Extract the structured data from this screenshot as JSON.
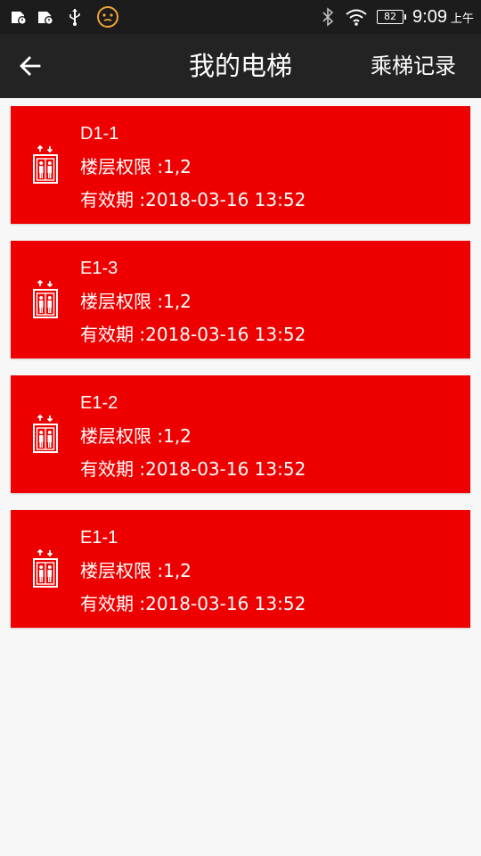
{
  "status_bar": {
    "time": "9:09",
    "ampm": "上午",
    "battery": "82",
    "icons": [
      "storage-card-icon",
      "storage-card-icon",
      "usb-icon",
      "face-icon",
      "bluetooth-icon",
      "wifi-icon",
      "battery-icon"
    ]
  },
  "header": {
    "title": "我的电梯",
    "records_label": "乘梯记录"
  },
  "elevators": [
    {
      "name": "D1-1",
      "floors": "楼层权限 :1,2",
      "validity": "有效期 :2018-03-16 13:52"
    },
    {
      "name": "E1-3",
      "floors": "楼层权限 :1,2",
      "validity": "有效期 :2018-03-16 13:52"
    },
    {
      "name": "E1-2",
      "floors": "楼层权限 :1,2",
      "validity": "有效期 :2018-03-16 13:52"
    },
    {
      "name": "E1-1",
      "floors": "楼层权限 :1,2",
      "validity": "有效期 :2018-03-16 13:52"
    }
  ],
  "colors": {
    "card": "#ee0000",
    "app_bar": "#232323",
    "status_bar": "#1c1c1c",
    "background": "#f7f7f7"
  }
}
